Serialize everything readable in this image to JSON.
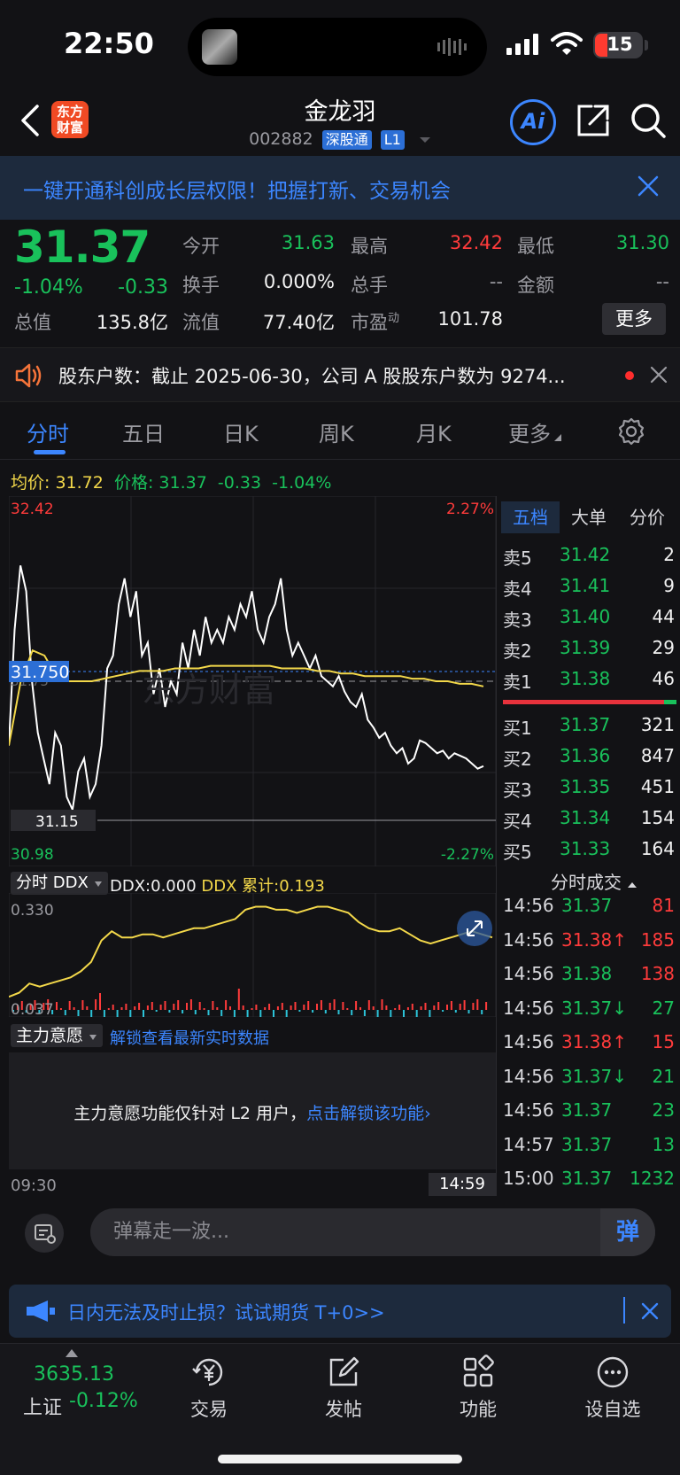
{
  "status_bar": {
    "time": "22:50",
    "battery": "15"
  },
  "header": {
    "logo_line1": "东方",
    "logo_line2": "财富",
    "stock_name": "金龙羽",
    "stock_code": "002882",
    "tag_connect": "深股通",
    "tag_level": "L1",
    "ai_label": "Ai"
  },
  "promo": {
    "text": "一键开通科创成长层权限！把握打新、交易机会"
  },
  "quote": {
    "price": "31.37",
    "pct": "-1.04%",
    "change": "-0.33",
    "fields": [
      {
        "label": "今开",
        "value": "31.63",
        "color": "green"
      },
      {
        "label": "最高",
        "value": "32.42",
        "color": "red"
      },
      {
        "label": "最低",
        "value": "31.30",
        "color": "green"
      },
      {
        "label": "换手",
        "value": "0.000%",
        "color": "white"
      },
      {
        "label": "总手",
        "value": "--",
        "color": "gray"
      },
      {
        "label": "金额",
        "value": "--",
        "color": "gray"
      },
      {
        "label": "总值",
        "value": "135.8亿",
        "color": "white"
      },
      {
        "label": "流值",
        "value": "77.40亿",
        "color": "white"
      },
      {
        "label": "市盈",
        "sup": "动",
        "value": "101.78",
        "color": "white"
      }
    ],
    "more_label": "更多"
  },
  "notice": {
    "text": "股东户数：截止 2025-06-30，公司 A 股股东户数为 9274..."
  },
  "tabs": [
    "分时",
    "五日",
    "日K",
    "周K",
    "月K",
    "更多"
  ],
  "chart_info": {
    "avg_label": "均价:",
    "avg_value": "31.72",
    "price_label": "价格:",
    "price_value": "31.37",
    "change": "-0.33",
    "pct": "-1.04%"
  },
  "chart_data": {
    "type": "line",
    "ylim": [
      30.98,
      32.42
    ],
    "y_top_label": "32.42",
    "y_bottom_label": "30.98",
    "pct_top_label": "2.27%",
    "pct_bottom_label": "-2.27%",
    "prev_close_label": "31.75",
    "crosshair_label": "31.750",
    "cursor_label": "31.15",
    "x_start": "09:30",
    "x_end": "14:59",
    "series": [
      {
        "values": [
          31.45,
          31.9,
          32.15,
          32.05,
          31.7,
          31.5,
          31.4,
          31.3,
          31.5,
          31.45,
          31.25,
          31.2,
          31.35,
          31.4,
          31.25,
          31.3,
          31.45,
          31.75,
          31.8,
          32.0,
          32.1,
          31.95,
          32.05,
          31.8,
          31.85,
          31.65,
          31.75,
          31.6,
          31.7,
          31.65,
          31.85,
          31.75,
          31.9,
          31.8,
          31.95,
          31.85,
          31.9,
          31.85,
          31.95,
          31.9,
          32.0,
          31.95,
          32.05,
          31.9,
          31.85,
          31.95,
          32.0,
          32.1,
          31.9,
          31.8,
          31.85,
          31.8,
          31.75,
          31.8,
          31.72,
          31.7,
          31.68,
          31.72,
          31.66,
          31.62,
          31.6,
          31.65,
          31.55,
          31.52,
          31.48,
          31.5,
          31.45,
          31.42,
          31.44,
          31.38,
          31.4,
          31.47,
          31.46,
          31.44,
          31.42,
          31.43,
          31.4,
          31.42,
          31.41,
          31.4,
          31.38,
          31.36,
          31.37
        ]
      },
      {
        "values": [
          31.45,
          31.7,
          31.82,
          31.8,
          31.72,
          31.7,
          31.7,
          31.7,
          31.71,
          31.72,
          31.73,
          31.74,
          31.74,
          31.74,
          31.75,
          31.75,
          31.75,
          31.76,
          31.76,
          31.76,
          31.76,
          31.76,
          31.76,
          31.75,
          31.75,
          31.75,
          31.74,
          31.74,
          31.73,
          31.73,
          31.72,
          31.72,
          31.72,
          31.72,
          31.71,
          31.71,
          31.7,
          31.7,
          31.69,
          31.69,
          31.68
        ]
      }
    ]
  },
  "ddx": {
    "tag": "分时 DDX",
    "ddx_label": "DDX:",
    "ddx_value": "0.000",
    "cum_label": "DDX 累计:",
    "cum_value": "0.193",
    "y_top": "0.330",
    "y_bottom": "0.037",
    "values": [
      0.037,
      0.05,
      0.08,
      0.07,
      0.08,
      0.09,
      0.1,
      0.12,
      0.15,
      0.22,
      0.25,
      0.23,
      0.23,
      0.24,
      0.24,
      0.23,
      0.24,
      0.25,
      0.26,
      0.26,
      0.27,
      0.28,
      0.29,
      0.32,
      0.33,
      0.33,
      0.32,
      0.32,
      0.31,
      0.32,
      0.33,
      0.33,
      0.32,
      0.31,
      0.28,
      0.26,
      0.25,
      0.25,
      0.26,
      0.24,
      0.22,
      0.21,
      0.22,
      0.23,
      0.24,
      0.25,
      0.24,
      0.23
    ]
  },
  "main_force": {
    "tag": "主力意愿",
    "link": "解锁查看最新实时数据",
    "locked_text": "主力意愿功能仅针对 L2 用户，",
    "locked_link": "点击解锁该功能"
  },
  "order_book": {
    "tabs": [
      "五档",
      "大单",
      "分价"
    ],
    "asks": [
      {
        "label": "卖5",
        "price": "31.42",
        "vol": "2"
      },
      {
        "label": "卖4",
        "price": "31.41",
        "vol": "9"
      },
      {
        "label": "卖3",
        "price": "31.40",
        "vol": "44"
      },
      {
        "label": "卖2",
        "price": "31.39",
        "vol": "29"
      },
      {
        "label": "卖1",
        "price": "31.38",
        "vol": "46"
      }
    ],
    "bids": [
      {
        "label": "买1",
        "price": "31.37",
        "vol": "321"
      },
      {
        "label": "买2",
        "price": "31.36",
        "vol": "847"
      },
      {
        "label": "买3",
        "price": "31.35",
        "vol": "451"
      },
      {
        "label": "买4",
        "price": "31.34",
        "vol": "154"
      },
      {
        "label": "买5",
        "price": "31.33",
        "vol": "164"
      }
    ]
  },
  "trades": {
    "title": "分时成交",
    "rows": [
      {
        "time": "14:56",
        "price": "31.37",
        "vol": "81",
        "vcolor": "red"
      },
      {
        "time": "14:56",
        "price": "31.38↑",
        "vol": "185",
        "vcolor": "red",
        "pcolor": "red"
      },
      {
        "time": "14:56",
        "price": "31.38",
        "vol": "138",
        "vcolor": "red"
      },
      {
        "time": "14:56",
        "price": "31.37↓",
        "vol": "27",
        "vcolor": "green"
      },
      {
        "time": "14:56",
        "price": "31.38↑",
        "vol": "15",
        "vcolor": "red",
        "pcolor": "red"
      },
      {
        "time": "14:56",
        "price": "31.37↓",
        "vol": "21",
        "vcolor": "green"
      },
      {
        "time": "14:56",
        "price": "31.37",
        "vol": "23",
        "vcolor": "green"
      },
      {
        "time": "14:57",
        "price": "31.37",
        "vol": "13",
        "vcolor": "green"
      },
      {
        "time": "15:00",
        "price": "31.37",
        "vol": "1232",
        "vcolor": "green"
      }
    ]
  },
  "comment": {
    "placeholder": "弹幕走一波...",
    "button": "弹"
  },
  "futures": {
    "text": "日内无法及时止损？试试期货 T+0>>"
  },
  "bottom_nav": {
    "index_value": "3635.13",
    "index_name": "上证",
    "index_pct": "-0.12%",
    "items": [
      "交易",
      "发帖",
      "功能",
      "设自选"
    ]
  }
}
